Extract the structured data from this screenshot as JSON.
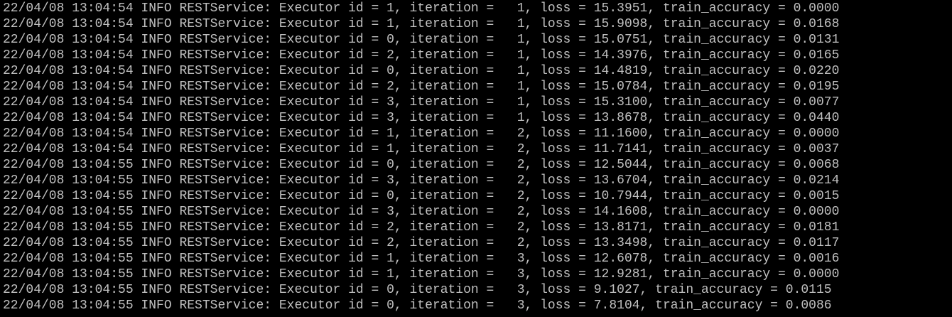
{
  "terminal": {
    "background": "#000000",
    "foreground": "#c0c0c0",
    "lines": [
      "22/04/08 13:04:54 INFO RESTService: Executor id = 1, iteration =   1, loss = 15.3951, train_accuracy = 0.0000",
      "22/04/08 13:04:54 INFO RESTService: Executor id = 1, iteration =   1, loss = 15.9098, train_accuracy = 0.0168",
      "22/04/08 13:04:54 INFO RESTService: Executor id = 0, iteration =   1, loss = 15.0751, train_accuracy = 0.0131",
      "22/04/08 13:04:54 INFO RESTService: Executor id = 2, iteration =   1, loss = 14.3976, train_accuracy = 0.0165",
      "22/04/08 13:04:54 INFO RESTService: Executor id = 0, iteration =   1, loss = 14.4819, train_accuracy = 0.0220",
      "22/04/08 13:04:54 INFO RESTService: Executor id = 2, iteration =   1, loss = 15.0784, train_accuracy = 0.0195",
      "22/04/08 13:04:54 INFO RESTService: Executor id = 3, iteration =   1, loss = 15.3100, train_accuracy = 0.0077",
      "22/04/08 13:04:54 INFO RESTService: Executor id = 3, iteration =   1, loss = 13.8678, train_accuracy = 0.0440",
      "22/04/08 13:04:54 INFO RESTService: Executor id = 1, iteration =   2, loss = 11.1600, train_accuracy = 0.0000",
      "22/04/08 13:04:54 INFO RESTService: Executor id = 1, iteration =   2, loss = 11.7141, train_accuracy = 0.0037",
      "22/04/08 13:04:55 INFO RESTService: Executor id = 0, iteration =   2, loss = 12.5044, train_accuracy = 0.0068",
      "22/04/08 13:04:55 INFO RESTService: Executor id = 3, iteration =   2, loss = 13.6704, train_accuracy = 0.0214",
      "22/04/08 13:04:55 INFO RESTService: Executor id = 0, iteration =   2, loss = 10.7944, train_accuracy = 0.0015",
      "22/04/08 13:04:55 INFO RESTService: Executor id = 3, iteration =   2, loss = 14.1608, train_accuracy = 0.0000",
      "22/04/08 13:04:55 INFO RESTService: Executor id = 2, iteration =   2, loss = 13.8171, train_accuracy = 0.0181",
      "22/04/08 13:04:55 INFO RESTService: Executor id = 2, iteration =   2, loss = 13.3498, train_accuracy = 0.0117",
      "22/04/08 13:04:55 INFO RESTService: Executor id = 1, iteration =   3, loss = 12.6078, train_accuracy = 0.0016",
      "22/04/08 13:04:55 INFO RESTService: Executor id = 1, iteration =   3, loss = 12.9281, train_accuracy = 0.0000",
      "22/04/08 13:04:55 INFO RESTService: Executor id = 0, iteration =   3, loss = 9.1027, train_accuracy = 0.0115",
      "22/04/08 13:04:55 INFO RESTService: Executor id = 0, iteration =   3, loss = 7.8104, train_accuracy = 0.0086"
    ]
  }
}
